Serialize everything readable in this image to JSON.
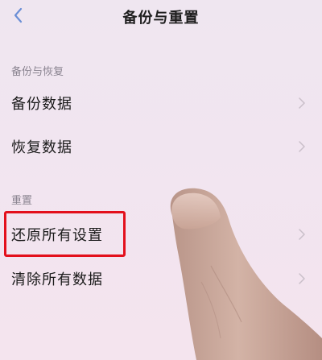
{
  "header": {
    "title": "备份与重置",
    "back_icon": "chevron-left-icon"
  },
  "sections": [
    {
      "header": "备份与恢复",
      "items": [
        {
          "label": "备份数据",
          "icon": "chevron-right-icon"
        },
        {
          "label": "恢复数据",
          "icon": "chevron-right-icon"
        }
      ]
    },
    {
      "header": "重置",
      "items": [
        {
          "label": "还原所有设置",
          "icon": "chevron-right-icon"
        },
        {
          "label": "清除所有数据",
          "icon": "chevron-right-icon"
        }
      ]
    }
  ],
  "colors": {
    "background": "#f1e5f0",
    "section_header": "#8a8490",
    "highlight": "#e3101c",
    "back_arrow": "#6b8fd6"
  }
}
